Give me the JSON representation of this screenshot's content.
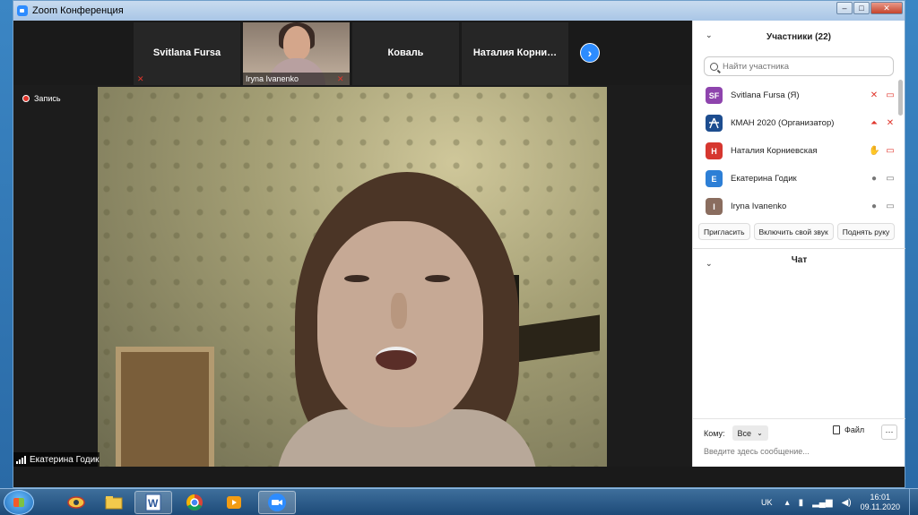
{
  "window": {
    "title": "Zoom Конференция"
  },
  "gallery": {
    "tiles": [
      {
        "name": "Svitlana Fursa"
      },
      {
        "name": "Iryna Ivanenko"
      },
      {
        "name": "Коваль"
      },
      {
        "name": "Наталия  Корни…"
      }
    ]
  },
  "recording": {
    "label": "Запись"
  },
  "active_speaker": {
    "name": "Екатерина Годик"
  },
  "participants_panel": {
    "title": "Участники (22)",
    "search_placeholder": "Найти участника",
    "list": [
      {
        "initials": "SF",
        "name": "Svitlana Fursa (Я)",
        "color": "#8e44ad"
      },
      {
        "initials": "",
        "name": "КМАН 2020 (Организатор)",
        "color": "#1d4d8f"
      },
      {
        "initials": "Н",
        "name": "Наталия Корниевская",
        "color": "#d6372f"
      },
      {
        "initials": "Е",
        "name": "Екатерина Годик",
        "color": "#2d7fd6"
      },
      {
        "initials": "I",
        "name": "Iryna Ivanenko",
        "color": "#8a6d5f"
      }
    ],
    "buttons": {
      "invite": "Пригласить",
      "unmute": "Включить свой звук",
      "raise_hand": "Поднять руку"
    }
  },
  "chat": {
    "title": "Чат",
    "to_label": "Кому:",
    "to_value": "Все",
    "file_label": "Файл",
    "input_placeholder": "Введите здесь сообщение..."
  },
  "taskbar": {
    "language": "UK",
    "time": "16:01",
    "date": "09.11.2020"
  }
}
